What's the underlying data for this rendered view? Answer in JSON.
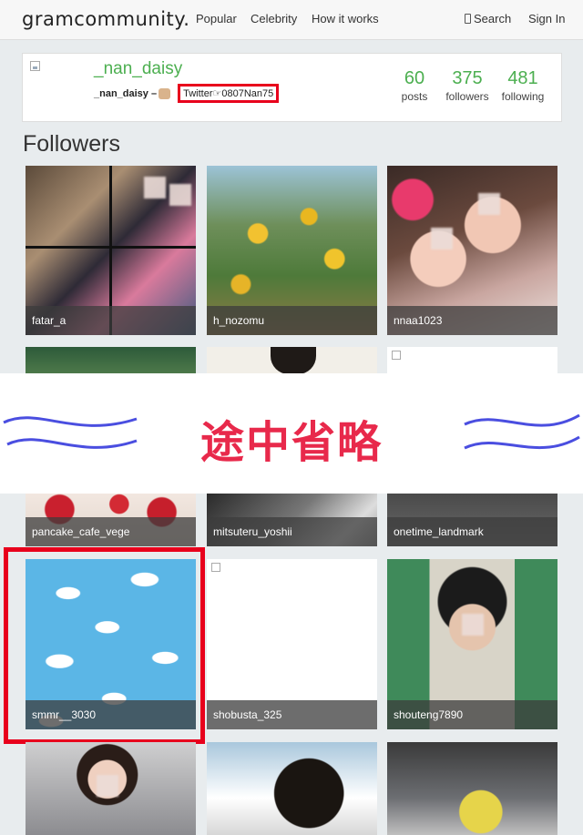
{
  "header": {
    "logo": "gramcommunity.",
    "nav": [
      {
        "label": "Popular"
      },
      {
        "label": "Celebrity"
      },
      {
        "label": "How it works"
      }
    ],
    "search_label": "Search",
    "signin_label": "Sign In"
  },
  "profile": {
    "username": "_nan_daisy",
    "bio_name": "_nan_daisy –",
    "bio_highlight": "Twitter☞0807Nan75",
    "stats": [
      {
        "value": "60",
        "label": "posts"
      },
      {
        "value": "375",
        "label": "followers"
      },
      {
        "value": "481",
        "label": "following"
      }
    ]
  },
  "section_title": "Followers",
  "followers": [
    {
      "name": "fatar_a"
    },
    {
      "name": "h_nozomu"
    },
    {
      "name": "nnaa1023"
    },
    {
      "name": "pancake_cafe_vege"
    },
    {
      "name": "mitsuteru_yoshii"
    },
    {
      "name": "onetime_landmark"
    },
    {
      "name": "smmr__3030"
    },
    {
      "name": "shobusta_325"
    },
    {
      "name": "shouteng7890"
    }
  ],
  "omitted_banner": "途中省略",
  "colors": {
    "accent_green": "#4caf50",
    "highlight_red": "#e8001c",
    "banner_text": "#e8294b",
    "wave_blue": "#4a4ee0"
  }
}
